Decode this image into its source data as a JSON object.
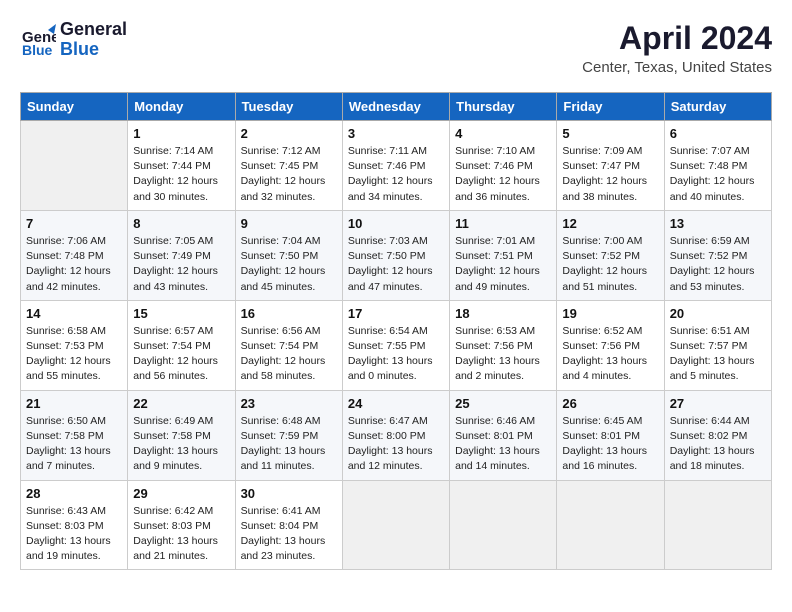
{
  "header": {
    "logo_line1": "General",
    "logo_line2": "Blue",
    "title": "April 2024",
    "subtitle": "Center, Texas, United States"
  },
  "weekdays": [
    "Sunday",
    "Monday",
    "Tuesday",
    "Wednesday",
    "Thursday",
    "Friday",
    "Saturday"
  ],
  "weeks": [
    [
      {
        "num": "",
        "info": ""
      },
      {
        "num": "1",
        "info": "Sunrise: 7:14 AM\nSunset: 7:44 PM\nDaylight: 12 hours\nand 30 minutes."
      },
      {
        "num": "2",
        "info": "Sunrise: 7:12 AM\nSunset: 7:45 PM\nDaylight: 12 hours\nand 32 minutes."
      },
      {
        "num": "3",
        "info": "Sunrise: 7:11 AM\nSunset: 7:46 PM\nDaylight: 12 hours\nand 34 minutes."
      },
      {
        "num": "4",
        "info": "Sunrise: 7:10 AM\nSunset: 7:46 PM\nDaylight: 12 hours\nand 36 minutes."
      },
      {
        "num": "5",
        "info": "Sunrise: 7:09 AM\nSunset: 7:47 PM\nDaylight: 12 hours\nand 38 minutes."
      },
      {
        "num": "6",
        "info": "Sunrise: 7:07 AM\nSunset: 7:48 PM\nDaylight: 12 hours\nand 40 minutes."
      }
    ],
    [
      {
        "num": "7",
        "info": "Sunrise: 7:06 AM\nSunset: 7:48 PM\nDaylight: 12 hours\nand 42 minutes."
      },
      {
        "num": "8",
        "info": "Sunrise: 7:05 AM\nSunset: 7:49 PM\nDaylight: 12 hours\nand 43 minutes."
      },
      {
        "num": "9",
        "info": "Sunrise: 7:04 AM\nSunset: 7:50 PM\nDaylight: 12 hours\nand 45 minutes."
      },
      {
        "num": "10",
        "info": "Sunrise: 7:03 AM\nSunset: 7:50 PM\nDaylight: 12 hours\nand 47 minutes."
      },
      {
        "num": "11",
        "info": "Sunrise: 7:01 AM\nSunset: 7:51 PM\nDaylight: 12 hours\nand 49 minutes."
      },
      {
        "num": "12",
        "info": "Sunrise: 7:00 AM\nSunset: 7:52 PM\nDaylight: 12 hours\nand 51 minutes."
      },
      {
        "num": "13",
        "info": "Sunrise: 6:59 AM\nSunset: 7:52 PM\nDaylight: 12 hours\nand 53 minutes."
      }
    ],
    [
      {
        "num": "14",
        "info": "Sunrise: 6:58 AM\nSunset: 7:53 PM\nDaylight: 12 hours\nand 55 minutes."
      },
      {
        "num": "15",
        "info": "Sunrise: 6:57 AM\nSunset: 7:54 PM\nDaylight: 12 hours\nand 56 minutes."
      },
      {
        "num": "16",
        "info": "Sunrise: 6:56 AM\nSunset: 7:54 PM\nDaylight: 12 hours\nand 58 minutes."
      },
      {
        "num": "17",
        "info": "Sunrise: 6:54 AM\nSunset: 7:55 PM\nDaylight: 13 hours\nand 0 minutes."
      },
      {
        "num": "18",
        "info": "Sunrise: 6:53 AM\nSunset: 7:56 PM\nDaylight: 13 hours\nand 2 minutes."
      },
      {
        "num": "19",
        "info": "Sunrise: 6:52 AM\nSunset: 7:56 PM\nDaylight: 13 hours\nand 4 minutes."
      },
      {
        "num": "20",
        "info": "Sunrise: 6:51 AM\nSunset: 7:57 PM\nDaylight: 13 hours\nand 5 minutes."
      }
    ],
    [
      {
        "num": "21",
        "info": "Sunrise: 6:50 AM\nSunset: 7:58 PM\nDaylight: 13 hours\nand 7 minutes."
      },
      {
        "num": "22",
        "info": "Sunrise: 6:49 AM\nSunset: 7:58 PM\nDaylight: 13 hours\nand 9 minutes."
      },
      {
        "num": "23",
        "info": "Sunrise: 6:48 AM\nSunset: 7:59 PM\nDaylight: 13 hours\nand 11 minutes."
      },
      {
        "num": "24",
        "info": "Sunrise: 6:47 AM\nSunset: 8:00 PM\nDaylight: 13 hours\nand 12 minutes."
      },
      {
        "num": "25",
        "info": "Sunrise: 6:46 AM\nSunset: 8:01 PM\nDaylight: 13 hours\nand 14 minutes."
      },
      {
        "num": "26",
        "info": "Sunrise: 6:45 AM\nSunset: 8:01 PM\nDaylight: 13 hours\nand 16 minutes."
      },
      {
        "num": "27",
        "info": "Sunrise: 6:44 AM\nSunset: 8:02 PM\nDaylight: 13 hours\nand 18 minutes."
      }
    ],
    [
      {
        "num": "28",
        "info": "Sunrise: 6:43 AM\nSunset: 8:03 PM\nDaylight: 13 hours\nand 19 minutes."
      },
      {
        "num": "29",
        "info": "Sunrise: 6:42 AM\nSunset: 8:03 PM\nDaylight: 13 hours\nand 21 minutes."
      },
      {
        "num": "30",
        "info": "Sunrise: 6:41 AM\nSunset: 8:04 PM\nDaylight: 13 hours\nand 23 minutes."
      },
      {
        "num": "",
        "info": ""
      },
      {
        "num": "",
        "info": ""
      },
      {
        "num": "",
        "info": ""
      },
      {
        "num": "",
        "info": ""
      }
    ]
  ]
}
